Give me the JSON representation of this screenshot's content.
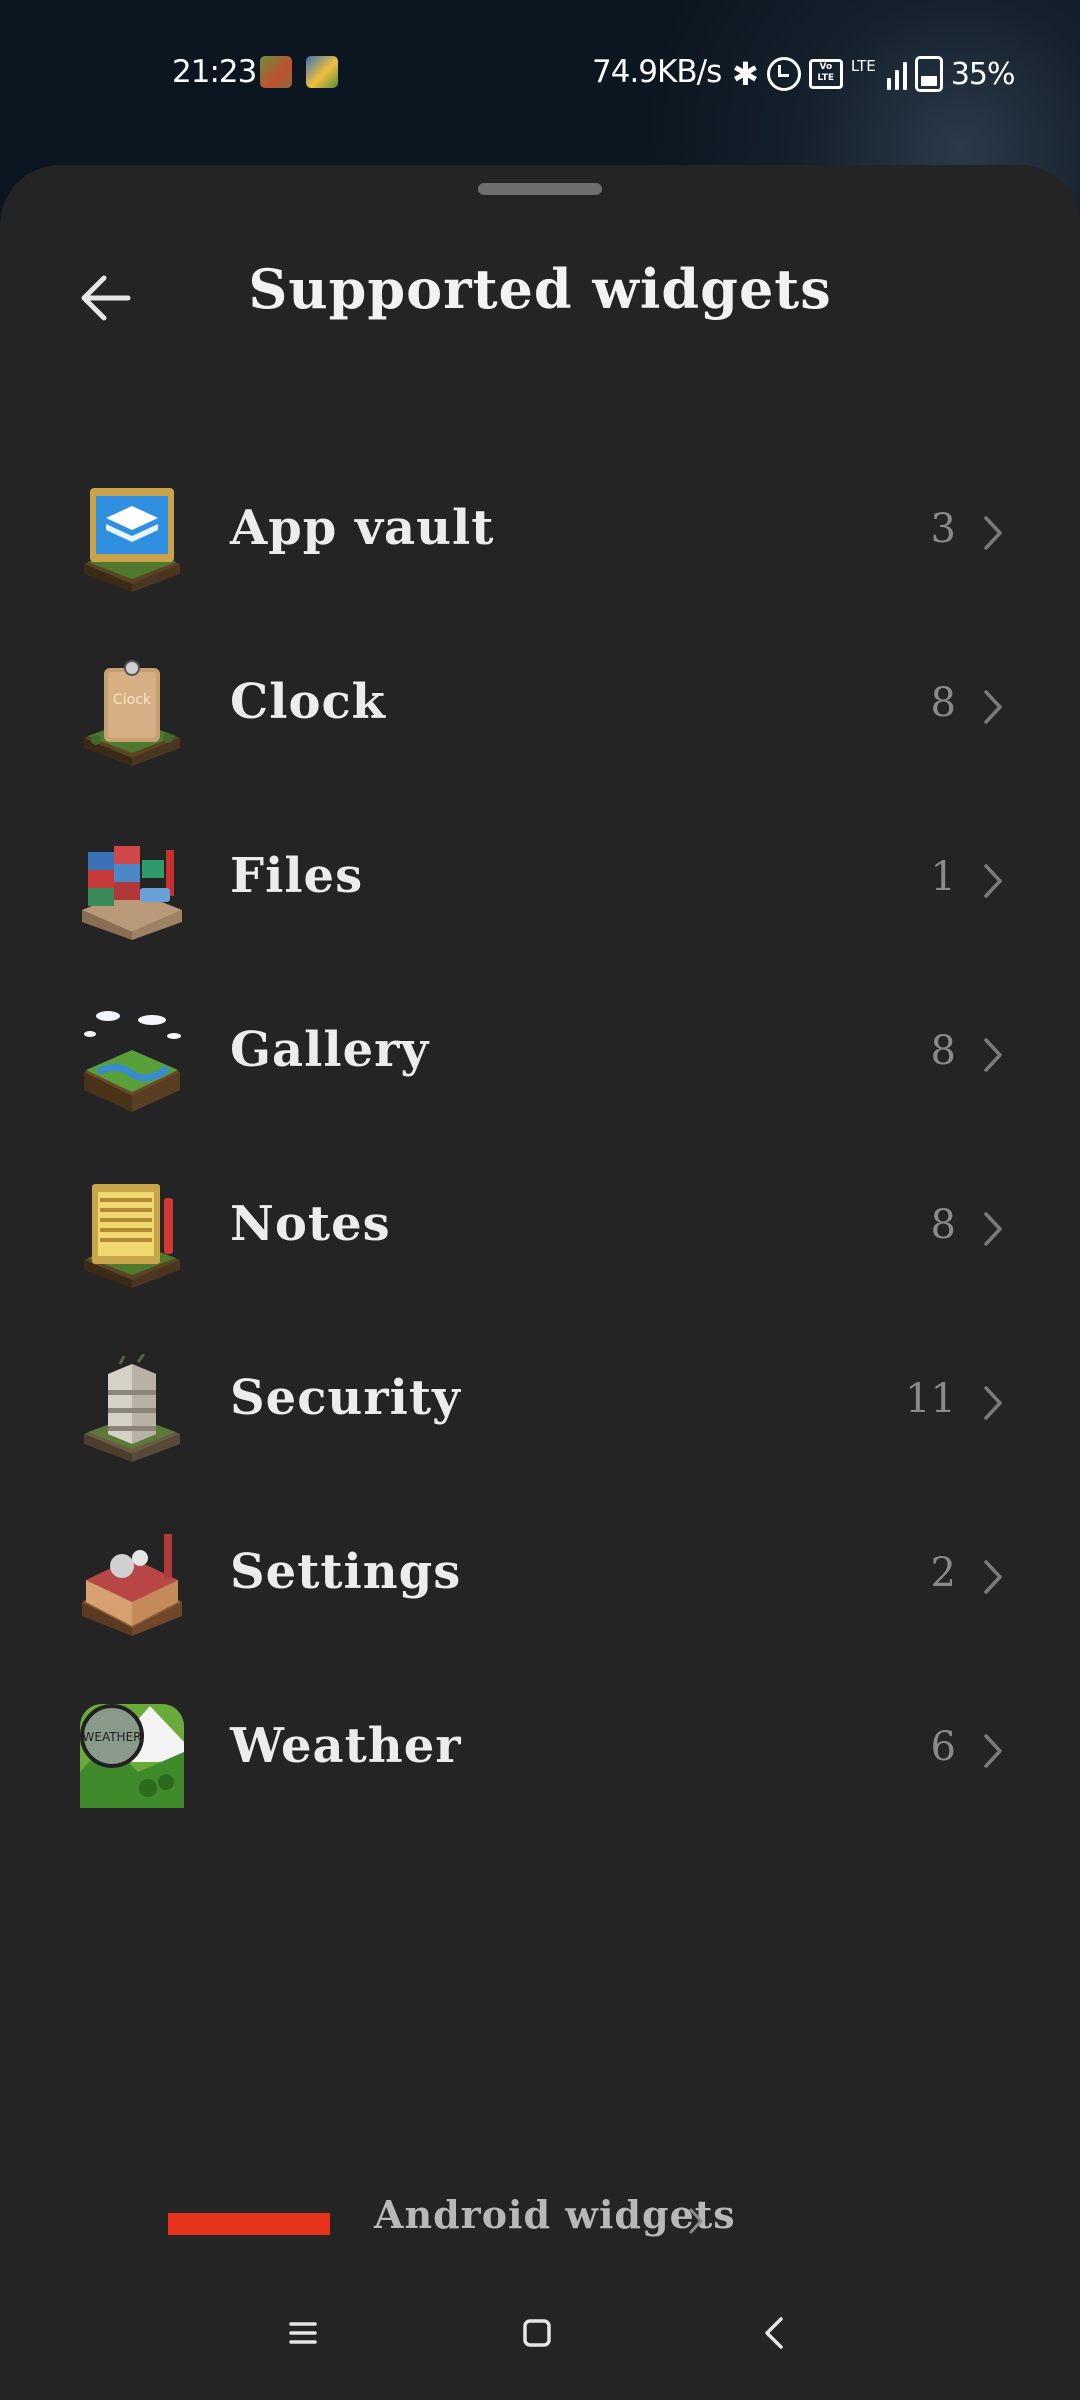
{
  "status_bar": {
    "time": "21:23",
    "network_speed": "74.9KB/s",
    "network_type": "LTE",
    "volte_label": "Vo LTE",
    "battery_percent": "35%",
    "notification_icons": [
      "maps-notification-icon",
      "gallery-notification-icon"
    ],
    "system_icons": [
      "bluetooth-icon",
      "alarm-icon",
      "volte-icon",
      "lte-icon",
      "signal-icon",
      "battery-icon"
    ]
  },
  "header": {
    "title": "Supported widgets",
    "back_icon": "back-arrow-icon"
  },
  "widgets": [
    {
      "name": "App vault",
      "count": "3",
      "icon": "app-vault-icon"
    },
    {
      "name": "Clock",
      "count": "8",
      "icon": "clock-icon"
    },
    {
      "name": "Files",
      "count": "1",
      "icon": "files-icon"
    },
    {
      "name": "Gallery",
      "count": "8",
      "icon": "gallery-icon"
    },
    {
      "name": "Notes",
      "count": "8",
      "icon": "notes-icon"
    },
    {
      "name": "Security",
      "count": "11",
      "icon": "security-icon"
    },
    {
      "name": "Settings",
      "count": "2",
      "icon": "settings-icon"
    },
    {
      "name": "Weather",
      "count": "6",
      "icon": "weather-icon"
    }
  ],
  "icon_text": {
    "clock": "Clock",
    "weather": "WEATHER"
  },
  "footer": {
    "android_widgets_label": "Android widgets"
  },
  "nav_bar": {
    "buttons": [
      "menu-icon",
      "home-icon",
      "back-icon"
    ]
  },
  "colors": {
    "sheet_background": "#242424",
    "text_primary": "#ececec",
    "text_secondary": "#8a8a8a",
    "accent_red": "#e8321c"
  }
}
